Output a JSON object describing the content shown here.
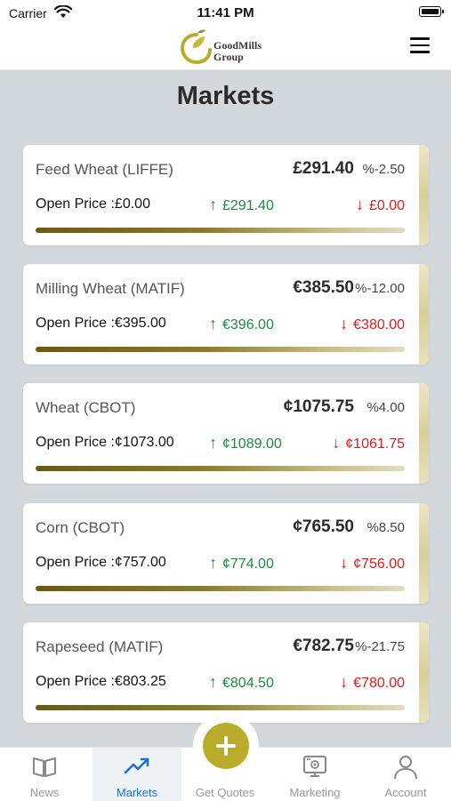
{
  "status_bar": {
    "carrier": "Carrier",
    "time": "11:41 PM"
  },
  "brand": {
    "name_line1": "GoodMills",
    "name_line2": "Group"
  },
  "page_title": "Markets",
  "markets": [
    {
      "name": "Feed Wheat (LIFFE)",
      "price": "£291.40",
      "change": "%-2.50",
      "open": "Open Price :£0.00",
      "high": "£291.40",
      "low": "£0.00"
    },
    {
      "name": "Milling Wheat (MATIF)",
      "price": "€385.50",
      "change": "%-12.00",
      "open": "Open Price :€395.00",
      "high": "€396.00",
      "low": "€380.00"
    },
    {
      "name": "Wheat (CBOT)",
      "price": "¢1075.75",
      "change": "%4.00",
      "open": "Open Price :¢1073.00",
      "high": "¢1089.00",
      "low": "¢1061.75"
    },
    {
      "name": "Corn (CBOT)",
      "price": "¢765.50",
      "change": "%8.50",
      "open": "Open Price :¢757.00",
      "high": "¢774.00",
      "low": "¢756.00"
    },
    {
      "name": "Rapeseed (MATIF)",
      "price": "€782.75",
      "change": "%-21.75",
      "open": "Open Price :€803.25",
      "high": "€804.50",
      "low": "€780.00"
    }
  ],
  "arrows": {
    "up": "↑",
    "down": "↓"
  },
  "tabs": [
    {
      "label": "News",
      "icon": "book-icon"
    },
    {
      "label": "Markets",
      "icon": "trending-up-icon",
      "active": true
    },
    {
      "label": "Get Quotes",
      "icon": "plus-icon"
    },
    {
      "label": "Marketing",
      "icon": "marketing-icon"
    },
    {
      "label": "Account",
      "icon": "user-icon"
    }
  ],
  "colors": {
    "accent": "#b9ac2a",
    "up": "#1e8a3c",
    "down": "#e01b1b",
    "active_tab": "#1a73c7"
  }
}
